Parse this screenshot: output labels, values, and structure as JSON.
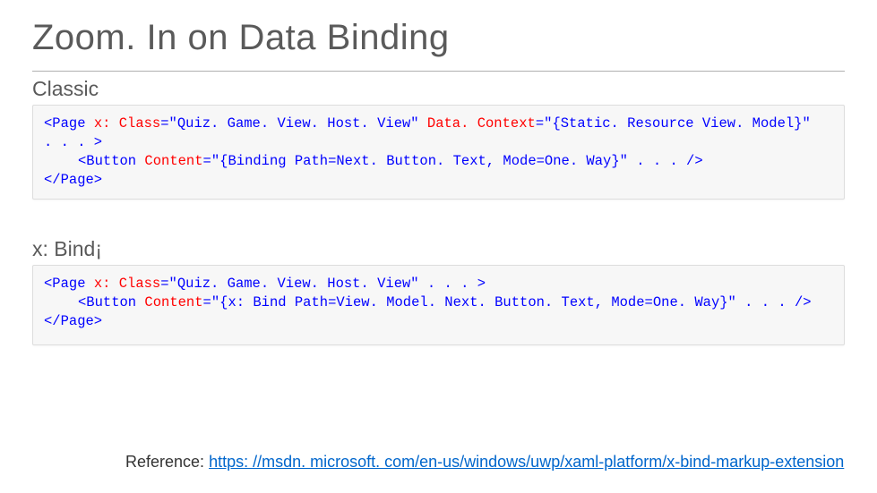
{
  "title": "Zoom. In on Data Binding",
  "section1": {
    "heading": "Classic",
    "code": {
      "l1_open": "<Page",
      "l1_attr1_name": " x: Class",
      "l1_attr1_eq": "=",
      "l1_attr1_val": "\"Quiz. Game. View. Host. View\"",
      "l1_attr2_name": " Data. Context",
      "l1_attr2_eq": "=",
      "l1_attr2_val": "\"{Static. Resource View. Model}\"",
      "l2": ". . . >",
      "l3_open": "<Button",
      "l3_attr_name": " Content",
      "l3_attr_eq": "=",
      "l3_attr_val": "\"{Binding Path=Next. Button. Text, Mode=One. Way}\"",
      "l3_close": " . . . />",
      "l4": "</Page>"
    }
  },
  "section2": {
    "heading": "x: Bind¡",
    "code": {
      "l1_open": "<Page",
      "l1_attr1_name": " x: Class",
      "l1_attr1_eq": "=",
      "l1_attr1_val": "\"Quiz. Game. View. Host. View\"",
      "l1_close": " . . . >",
      "l2_open": "<Button",
      "l2_attr_name": " Content",
      "l2_attr_eq": "=",
      "l2_attr_val": "\"{x: Bind Path=View. Model. Next. Button. Text, Mode=One. Way}\"",
      "l2_close": " . . . />",
      "l3": "</Page>"
    }
  },
  "reference": {
    "label": "Reference: ",
    "url_text": "https: //msdn. microsoft. com/en-us/windows/uwp/xaml-platform/x-bind-markup-extension"
  }
}
